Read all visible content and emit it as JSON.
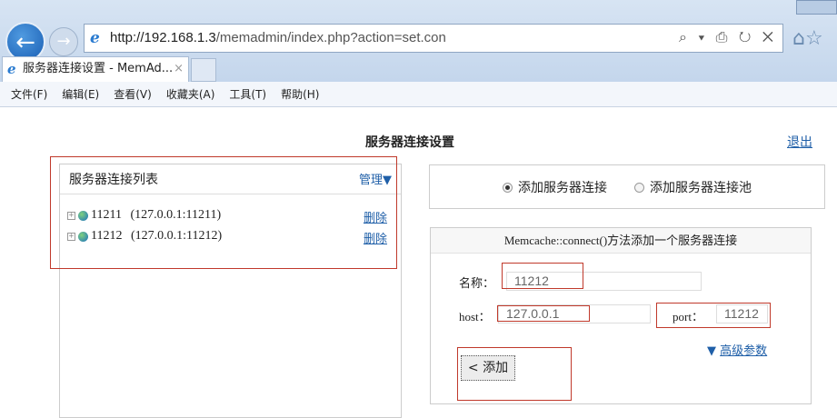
{
  "browser": {
    "url_host": "http://192.168.1.3",
    "url_path": "/memadmin/index.php?action=set.con",
    "tab_title": "服务器连接设置 - MemAd...",
    "tab_close": "×",
    "addr_tools": "⌕ ▾ ⎙ ↻ ✕"
  },
  "menu": [
    "文件(F)",
    "编辑(E)",
    "查看(V)",
    "收藏夹(A)",
    "工具(T)",
    "帮助(H)"
  ],
  "page": {
    "title": "服务器连接设置",
    "logout": "退出"
  },
  "list": {
    "title": "服务器连接列表",
    "manage": "管理▼",
    "servers": [
      {
        "name": "11211",
        "addr": "(127.0.0.1:11211)",
        "delete": "删除"
      },
      {
        "name": "11212",
        "addr": "(127.0.0.1:11212)",
        "delete": "删除"
      }
    ]
  },
  "mode": {
    "option1": "添加服务器连接",
    "option2": "添加服务器连接池",
    "selected": "option1"
  },
  "form": {
    "header": "Memcache::connect()方法添加一个服务器连接",
    "name_label": "名称：",
    "name_value": "11212",
    "host_label": "host：",
    "host_value": "127.0.0.1",
    "port_label": "port：",
    "port_value": "11212",
    "advanced": "高级参数",
    "advanced_arrow": "▼",
    "add_button": "< 添加"
  }
}
